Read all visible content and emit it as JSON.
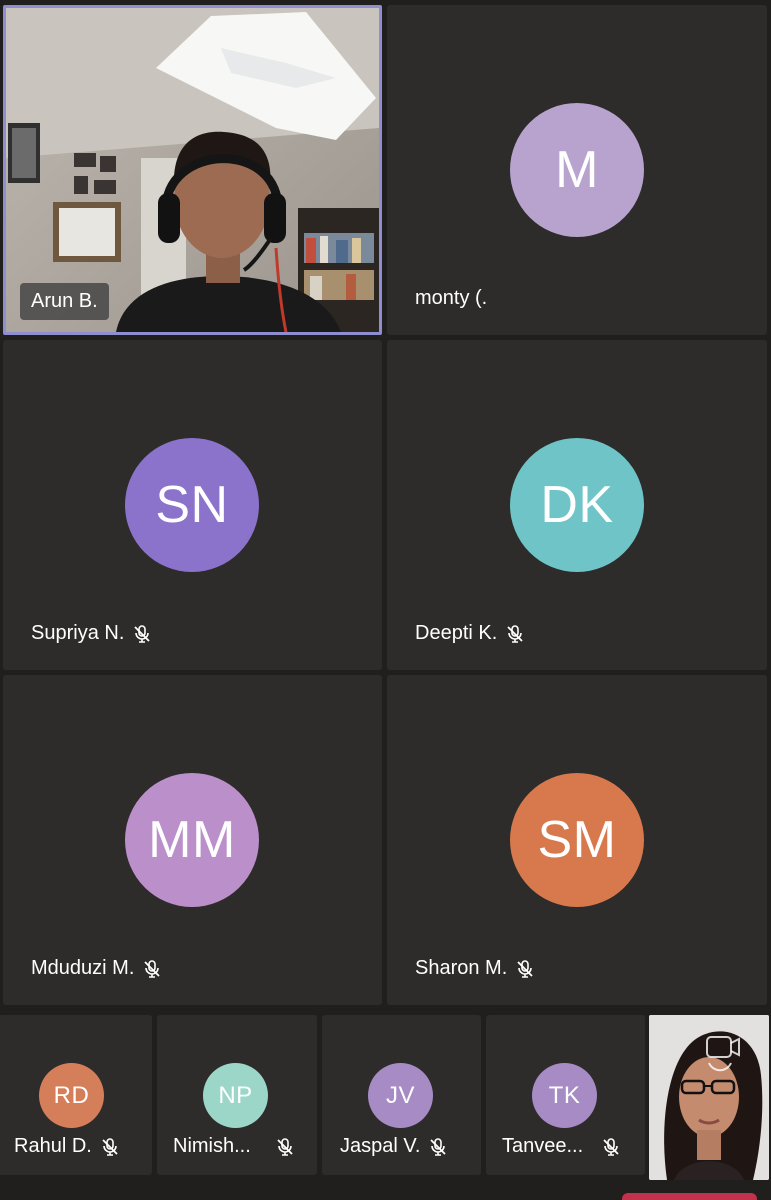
{
  "participants_main": [
    {
      "name": "Arun B.",
      "video": true
    },
    {
      "name": "monty (.",
      "initials": "M",
      "color": "#b7a3cd",
      "muted": false
    },
    {
      "name": "Supriya N.",
      "initials": "SN",
      "color": "#8b73cc",
      "muted": true
    },
    {
      "name": "Deepti K.",
      "initials": "DK",
      "color": "#6ec4c6",
      "muted": true
    },
    {
      "name": "Mduduzi M.",
      "initials": "MM",
      "color": "#bb8fc9",
      "muted": true
    },
    {
      "name": "Sharon M.",
      "initials": "SM",
      "color": "#d8794d",
      "muted": true
    }
  ],
  "participants_strip": [
    {
      "name": "Rahul D.",
      "initials": "RD",
      "color": "#d57f5a",
      "muted": true
    },
    {
      "name": "Nimish...",
      "initials": "NP",
      "color": "#9bd6c8",
      "muted": true
    },
    {
      "name": "Jaspal V.",
      "initials": "JV",
      "color": "#a68bc4",
      "muted": true
    },
    {
      "name": "Tanvee...",
      "initials": "TK",
      "color": "#a68bc4",
      "muted": true
    }
  ],
  "self_view": {
    "video": true
  }
}
